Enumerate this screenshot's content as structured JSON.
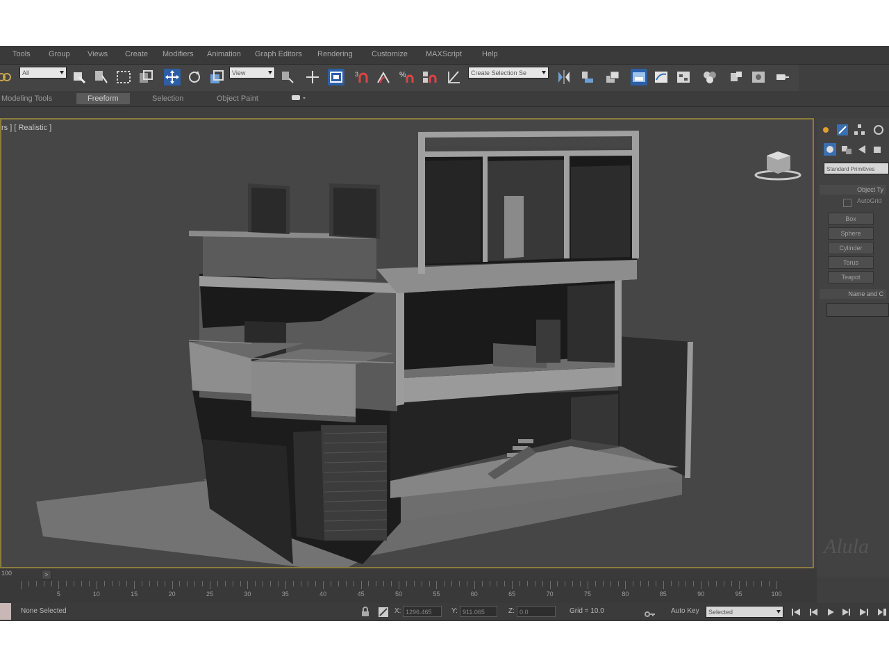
{
  "menu": [
    "Tools",
    "Group",
    "Views",
    "Create",
    "Modifiers",
    "Animation",
    "Graph Editors",
    "Rendering",
    "Customize",
    "MAXScript",
    "Help"
  ],
  "toolbar": {
    "filter_select": "All",
    "ref_coord_select": "View",
    "named_selection": "Create Selection Se",
    "icons": [
      "link-icon",
      "select-object-icon",
      "select-by-name-icon",
      "rect-region-icon",
      "window-crossing-icon",
      "move-icon",
      "rotate-icon",
      "scale-icon",
      "pivot-icon",
      "select-manipulate-icon",
      "keyboard-shortcut-icon",
      "snap-toggle-icon",
      "angle-snap-icon",
      "percent-snap-icon",
      "spinner-snap-icon",
      "edit-named-selection-icon",
      "mirror-icon",
      "align-icon",
      "layer-manager-icon",
      "graphite-toggle-icon",
      "curve-editor-icon",
      "schematic-view-icon",
      "material-editor-icon",
      "render-setup-icon",
      "rendered-frame-icon",
      "render-production-icon"
    ]
  },
  "ribbon": {
    "tabs": [
      "Modeling Tools",
      "Freeform",
      "Selection",
      "Object Paint"
    ],
    "active_tab": "Freeform"
  },
  "viewport": {
    "label": "rs ] [ Realistic ]",
    "frame_color": "#8a7e3a"
  },
  "command_panel": {
    "category_select": "Standard Primitives",
    "object_type_header": "Object Ty",
    "autogrid_label": "AutoGrid",
    "buttons": [
      "Box",
      "Sphere",
      "Cylinder",
      "Torus",
      "Teapot"
    ],
    "name_header": "Name and C",
    "watermark": "Alula"
  },
  "timeline": {
    "range_label": "100",
    "ticks": [
      "5",
      "10",
      "15",
      "20",
      "25",
      "30",
      "35",
      "40",
      "45",
      "50",
      "55",
      "60",
      "65",
      "70",
      "75",
      "80",
      "85",
      "90",
      "95",
      "100"
    ]
  },
  "status": {
    "selection_text": "None Selected",
    "x_label": "X:",
    "x_value": "1296.465",
    "y_label": "Y:",
    "y_value": "911.065",
    "z_label": "Z:",
    "z_value": "0.0",
    "grid_text": "Grid = 10.0",
    "auto_key": "Auto Key",
    "key_filter_select": "Selected"
  },
  "colors": {
    "accent": "#2b5fa8",
    "panel": "#3f3f3f",
    "viewport_bg": "#464646"
  }
}
